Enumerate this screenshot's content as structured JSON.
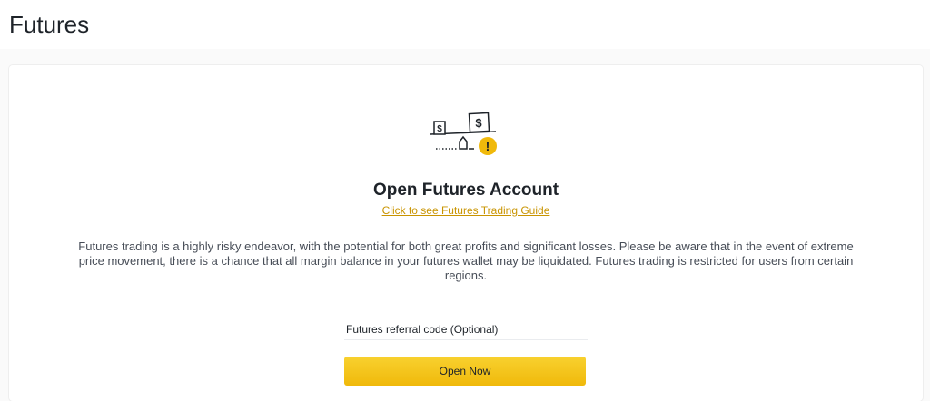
{
  "header": {
    "title": "Futures"
  },
  "main": {
    "heading": "Open Futures Account",
    "guide_link": "Click to see Futures Trading Guide",
    "warning": "Futures trading is a highly risky endeavor, with the potential for both great profits and significant losses. Please be aware that in the event of extreme price movement, there is a chance that all margin balance in your futures wallet may be liquidated. Futures trading is restricted for users from certain regions.",
    "referral_placeholder": "Futures referral code (Optional)",
    "open_button": "Open Now"
  },
  "illustration": {
    "icon": "balance-scale-warning-icon",
    "small_box_symbol": "$",
    "large_box_symbol": "$",
    "alert_symbol": "!"
  },
  "colors": {
    "accent": "#f0b90b",
    "link": "#c99400",
    "text": "#1e2329",
    "muted_text": "#474d57",
    "background": "#fafafa"
  }
}
